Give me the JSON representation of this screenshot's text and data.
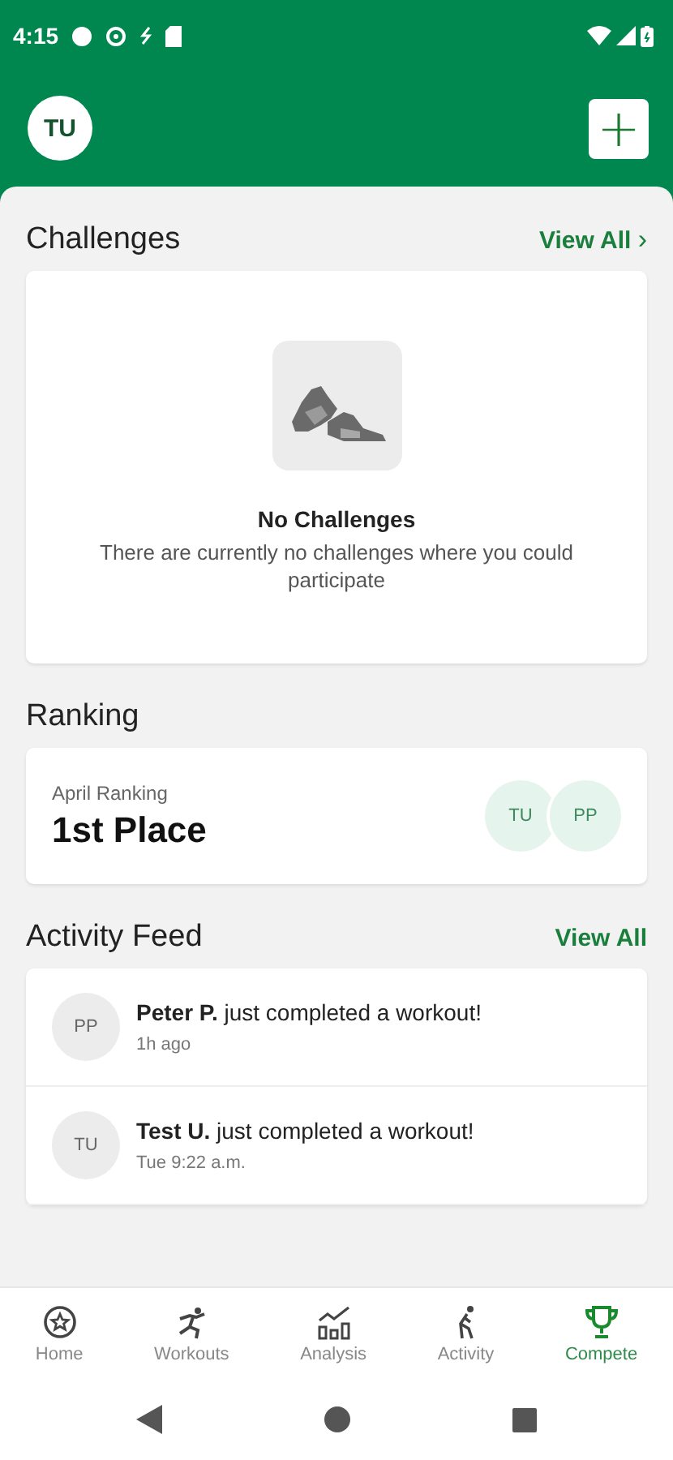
{
  "status_bar": {
    "time": "4:15"
  },
  "header": {
    "avatar": "TU",
    "add_button": "+"
  },
  "challenges": {
    "title": "Challenges",
    "link": "View All",
    "link_icon": "›",
    "empty_title": "No Challenges",
    "empty_text": "There are currently no challenges where you could participate"
  },
  "ranking": {
    "title": "Ranking",
    "label": "April Ranking",
    "place": "1st Place",
    "avatars": [
      "TU",
      "PP"
    ]
  },
  "activity_feed": {
    "title": "Activity Feed",
    "link": "View All",
    "items": [
      {
        "avatar": "PP",
        "text": "**Peter P.** just completed a workout!",
        "time": "1h ago"
      },
      {
        "avatar": "TU",
        "text": "**Test U.** just completed a workout!",
        "time": "Tue 9:22 a.m."
      }
    ]
  },
  "bottom_nav": [
    {
      "label": "Home",
      "kind": "home",
      "selected": false
    },
    {
      "label": "Workouts",
      "kind": "workouts",
      "selected": false
    },
    {
      "label": "Analysis",
      "kind": "analysis",
      "selected": false
    },
    {
      "label": "Activity",
      "kind": "activity",
      "selected": false
    },
    {
      "label": "Compete",
      "kind": "compete",
      "selected": true
    }
  ]
}
